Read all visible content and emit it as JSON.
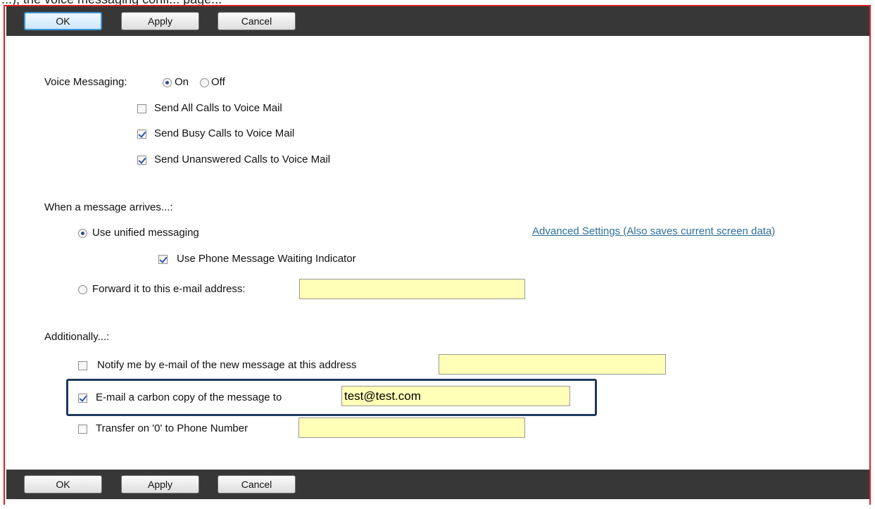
{
  "top_strip_text": "...), the voice messaging confi... page...",
  "toolbar": {
    "ok_label": "OK",
    "apply_label": "Apply",
    "cancel_label": "Cancel"
  },
  "voice_messaging": {
    "label": "Voice Messaging:",
    "on_label": "On",
    "off_label": "Off",
    "selected": "On",
    "send_all": {
      "label": "Send All Calls to Voice Mail",
      "checked": false
    },
    "send_busy": {
      "label": "Send Busy Calls to Voice Mail",
      "checked": true
    },
    "send_unanswered": {
      "label": "Send Unanswered Calls to Voice Mail",
      "checked": true
    }
  },
  "message_arrives": {
    "heading": "When a message arrives...:",
    "unified_label": "Use unified messaging",
    "advanced_link": "Advanced Settings (Also saves current screen data)",
    "mwi_label": "Use Phone Message Waiting Indicator",
    "mwi_checked": true,
    "forward_label": "Forward it to this e-mail address:",
    "forward_value": "",
    "selected": "unified"
  },
  "additionally": {
    "heading": "Additionally...:",
    "notify_label": "Notify me by e-mail of the new message at this address",
    "notify_checked": false,
    "notify_value": "",
    "cc_label": "E-mail a carbon copy of the message to",
    "cc_checked": true,
    "cc_value": "test@test.com",
    "transfer_label": "Transfer on '0' to Phone Number",
    "transfer_checked": false,
    "transfer_value": ""
  },
  "colors": {
    "toolbar_bg": "#373737",
    "frame_border": "#e02020",
    "field_bg": "#ffffb8",
    "link": "#2f6f9a",
    "highlight": "#1e3a5c"
  }
}
